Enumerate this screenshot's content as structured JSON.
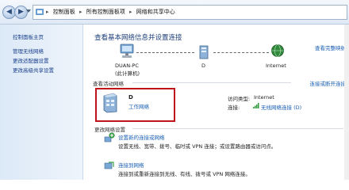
{
  "address": {
    "crumbs": [
      "控制面板",
      "所有控制面板项",
      "网络和共享中心"
    ]
  },
  "left_nav": {
    "home": "控制面板主页",
    "items": [
      "管理无线网络",
      "更改适配器设置",
      "更改高级共享设置"
    ]
  },
  "main": {
    "title": "查看基本网络信息并设置连接",
    "full_map": "查看完整映射",
    "map": {
      "computer": "DUAN-PC",
      "computer_sub": "(此计算机)",
      "network": "D",
      "internet": "Internet"
    },
    "active_section": "查看活动网络",
    "connect_disconnect": "连接或断开连接",
    "active_network": {
      "name": "D",
      "type": "工作网络",
      "access_label": "访问类型:",
      "access_value": "Internet",
      "conn_label": "连接:",
      "conn_value": "无线网络连接 (D)"
    },
    "change_section": "更改网络设置",
    "tasks": [
      {
        "title": "设置新的连接或网络",
        "desc": "设置无线、宽带、拨号、临时或 VPN 连接；或设置路由器或访问点。"
      },
      {
        "title": "连接到网络",
        "desc": "连接到或重新连接到无线、有线、拨号或 VPN 网络连接。"
      }
    ]
  },
  "colors": {
    "link": "#1a5fb4",
    "highlight": "#c0141b",
    "title": "#1e3f7a"
  }
}
